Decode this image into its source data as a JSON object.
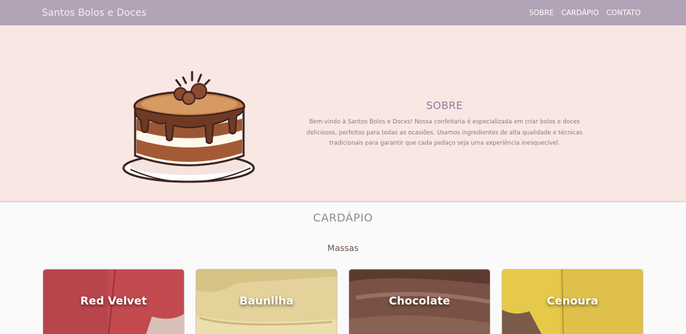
{
  "header": {
    "brand": "Santos Bolos e Doces",
    "nav": [
      "SOBRE",
      "CARDÁPIO",
      "CONTATO"
    ]
  },
  "about": {
    "title": "SOBRE",
    "description": "Bem-vindo à Santos Bolos e Doces! Nossa confeitaria é especializada em criar bolos e doces deliciosos, perfeitos para todas as ocasiões. Usamos ingredientes de alta qualidade e técnicas tradicionais para garantir que cada pedaço seja uma experiência inesquecível."
  },
  "menu": {
    "title": "CARDÁPIO",
    "subtitle": "Massas",
    "items": [
      {
        "name": "Red Velvet",
        "color": "#b9454c"
      },
      {
        "name": "Baunilha",
        "color": "#e3d29a"
      },
      {
        "name": "Chocolate",
        "color": "#7a5145"
      },
      {
        "name": "Cenoura",
        "color": "#e7c94a"
      }
    ]
  },
  "colors": {
    "navbar": "#b3a3b6",
    "about_bg": "#f9e7e4",
    "menu_bg": "#fafafa"
  }
}
